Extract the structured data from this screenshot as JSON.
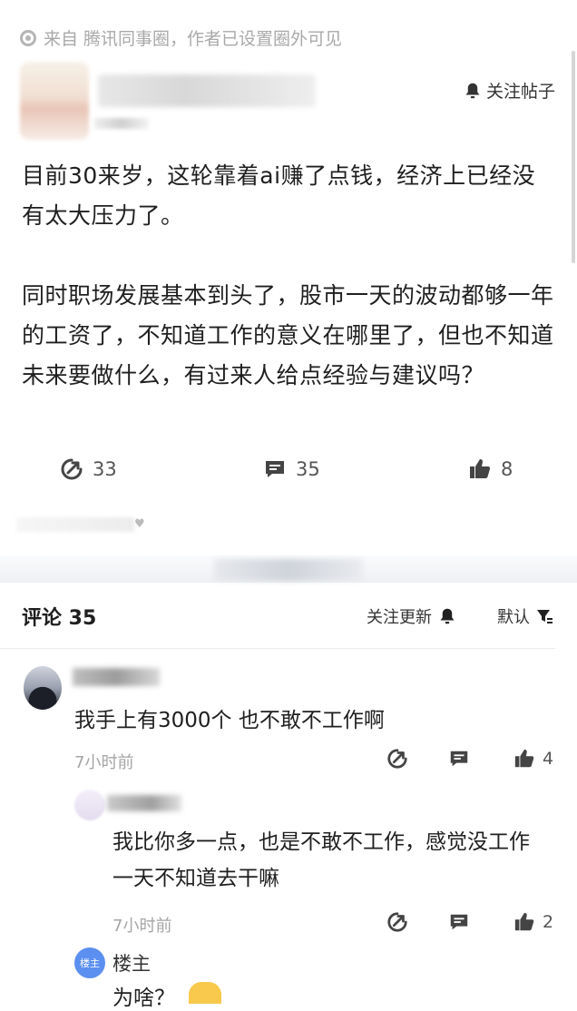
{
  "post": {
    "source": "来自 腾讯同事圈，作者已设置圈外可见",
    "follow_label": "关注帖子",
    "paragraphs": [
      "目前30来岁，这轮靠着ai赚了点钱，经济上已经没有太大压力了。",
      "同时职场发展基本到头了，股市一天的波动都够一年的工资了，不知道工作的意义在哪里了，但也不知道未来要做什么，有过来人给点经验与建议吗？"
    ],
    "stats": {
      "shares": "33",
      "comments": "35",
      "likes": "8"
    }
  },
  "comments_header": {
    "title": "评论 35",
    "follow_updates": "关注更新",
    "sort": "默认"
  },
  "comments": [
    {
      "text": "我手上有3000个 也不敢不工作啊",
      "time": "7小时前",
      "likes": "4"
    },
    {
      "text": "我比你多一点，也是不敢不工作，感觉没工作一天不知道去干嘛",
      "time": "7小时前",
      "likes": "2"
    }
  ],
  "op_reply": {
    "badge": "楼主",
    "name": "楼主",
    "text": "为啥？"
  },
  "icons": [
    "location-icon",
    "bell-icon",
    "share-icon",
    "comment-icon",
    "thumbs-up-icon",
    "filter-icon",
    "heart-icon"
  ]
}
